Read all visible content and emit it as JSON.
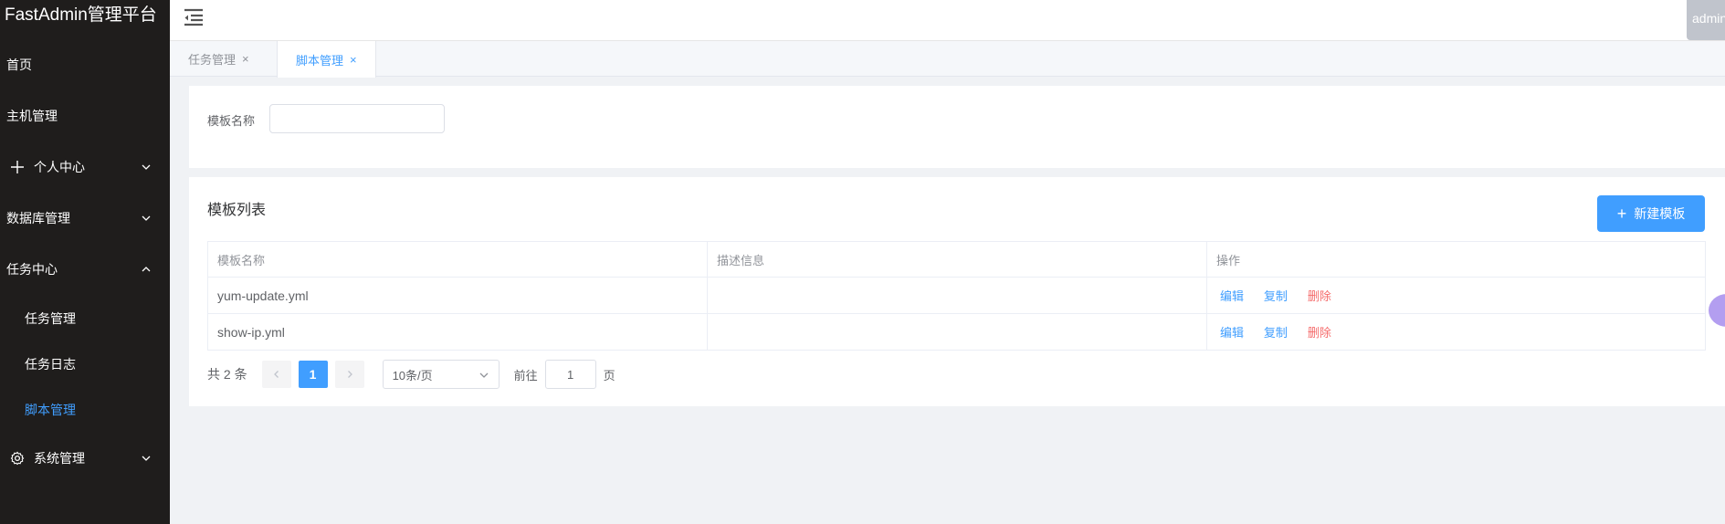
{
  "app": {
    "title": "FastAdmin管理平台"
  },
  "header": {
    "user": "admin"
  },
  "sidebar": {
    "items": [
      {
        "label": "首页"
      },
      {
        "label": "主机管理"
      },
      {
        "label": "个人中心"
      },
      {
        "label": "数据库管理"
      },
      {
        "label": "任务中心"
      },
      {
        "label": "系统管理"
      }
    ],
    "sub_items": [
      {
        "label": "任务管理"
      },
      {
        "label": "任务日志"
      },
      {
        "label": "脚本管理"
      }
    ]
  },
  "tabs": [
    {
      "label": "任务管理",
      "close": "×"
    },
    {
      "label": "脚本管理",
      "close": "×"
    }
  ],
  "search": {
    "label": "模板名称",
    "value": "",
    "placeholder": ""
  },
  "list": {
    "title": "模板列表",
    "new_button": "新建模板",
    "columns": [
      "模板名称",
      "描述信息",
      "操作"
    ],
    "rows": [
      {
        "name": "yum-update.yml",
        "desc": "",
        "ops": [
          "编辑",
          "复制",
          "删除"
        ]
      },
      {
        "name": "show-ip.yml",
        "desc": "",
        "ops": [
          "编辑",
          "复制",
          "删除"
        ]
      }
    ]
  },
  "pagination": {
    "total": "共 2 条",
    "current": "1",
    "page_size": "10条/页",
    "goto_label": "前往",
    "goto_value": "1",
    "goto_suffix": "页"
  },
  "colors": {
    "primary": "#409eff",
    "danger": "#f56c6c",
    "sidebar_bg": "#1f1d1c"
  }
}
